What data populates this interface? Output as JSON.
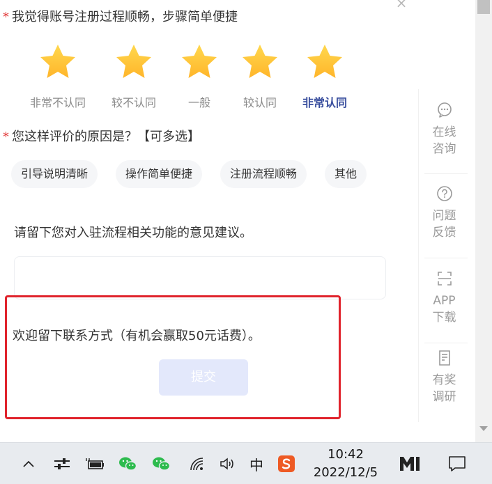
{
  "survey": {
    "q1": {
      "required_mark": "*",
      "title": "我觉得账号注册过程顺畅，步骤简单便捷",
      "options": [
        {
          "label": "非常不认同",
          "active": false
        },
        {
          "label": "较不认同",
          "active": false
        },
        {
          "label": "一般",
          "active": false
        },
        {
          "label": "较认同",
          "active": false
        },
        {
          "label": "非常认同",
          "active": true
        }
      ]
    },
    "q2": {
      "required_mark": "*",
      "title": "您这样评价的原因是？【可多选】",
      "chips": [
        "引导说明清晰",
        "操作简单便捷",
        "注册流程顺畅",
        "其他"
      ]
    },
    "suggestion_label": "请留下您对入驻流程相关功能的意见建议。",
    "contact_label": "欢迎留下联系方式（有机会赢取50元话费）。",
    "submit_label": "提交",
    "close_glyph": "×"
  },
  "side_toolbar": {
    "items": [
      {
        "icon": "chat-bubble-icon",
        "label": "在线\n咨询"
      },
      {
        "icon": "question-circle-icon",
        "label": "问题\n反馈"
      },
      {
        "icon": "scan-icon",
        "label": "APP\n下载"
      },
      {
        "icon": "document-edit-icon",
        "label": "有奖\n调研"
      }
    ]
  },
  "taskbar": {
    "ime_label": "中",
    "time": "10:42",
    "date": "2022/12/5"
  },
  "colors": {
    "accent": "#3a4f9e",
    "required": "#e23b3b",
    "highlight": "#e0232c",
    "star_fill": "#ffc93d",
    "submit_disabled": "#e3e8fb"
  }
}
